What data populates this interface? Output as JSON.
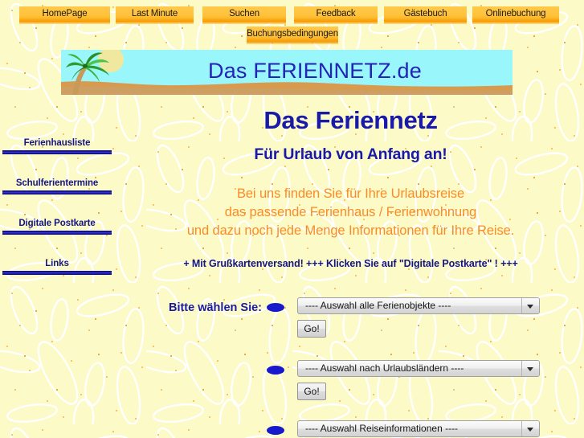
{
  "theme": {
    "background_color": "#fcfac6",
    "nav_button_color": "#ffc23c",
    "nav_button_shadow": "#faaf28",
    "heading_color": "#1a1aa8",
    "sidebar_text_color": "#151585",
    "sidebar_rule_color": "#14149a",
    "intro_text_color": "#fa8c28",
    "banner_sky_color": "#99f6fb",
    "banner_sand_color": "#d89a4e",
    "banner_title_color": "#2323b8",
    "bullet_color": "#1818cc"
  },
  "topnav": {
    "row1": [
      {
        "label": "HomePage"
      },
      {
        "label": "Last Minute"
      },
      {
        "label": "Suchen"
      },
      {
        "label": "Feedback"
      },
      {
        "label": "Gästebuch"
      },
      {
        "label": "Onlinebuchung"
      }
    ],
    "row2": [
      {
        "label": "Buchungsbedingungen"
      }
    ]
  },
  "banner": {
    "title": "Das FERIENNETZ.de",
    "palm_icon": "palm-tree-icon"
  },
  "sidebar": {
    "items": [
      {
        "label": "Ferienhausliste"
      },
      {
        "label": "Schulferientermine"
      },
      {
        "label": "Digitale Postkarte"
      },
      {
        "label": "Links"
      }
    ]
  },
  "main": {
    "title": "Das Feriennetz",
    "subtitle": "Für Urlaub von Anfang an!",
    "intro_lines": [
      "Bei uns finden Sie für Ihre Urlaubsreise",
      "das passende Ferienhaus / Ferienwohnung",
      "und dazu noch jede Menge Informationen für Ihre Reise."
    ],
    "promo": "+ Mit Grußkartenversand! +++ Klicken Sie auf \"Digitale Postkarte\" ! +++"
  },
  "form": {
    "prompt_label": "Bitte wählen Sie:",
    "go_label": "Go!",
    "selects": [
      {
        "value": "---- Auswahl alle Ferienobjekte ----",
        "has_go": true
      },
      {
        "value": "---- Auswahl nach Urlaubsländern ----",
        "has_go": true
      },
      {
        "value": "---- Auswahl Reiseinformationen ----",
        "has_go": false
      }
    ]
  }
}
